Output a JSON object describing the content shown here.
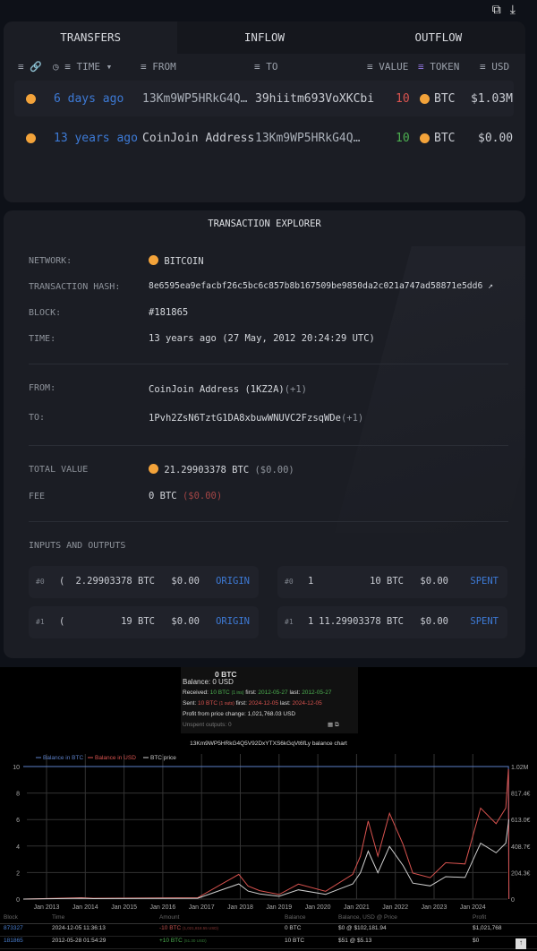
{
  "toolbar": {
    "copy_icon": "copy-icon",
    "download_icon": "download-icon"
  },
  "tabs": [
    {
      "label": "TRANSFERS",
      "active": true
    },
    {
      "label": "INFLOW"
    },
    {
      "label": "OUTFLOW"
    }
  ],
  "columns": {
    "time": "TIME",
    "from": "FROM",
    "to": "TO",
    "value": "VALUE",
    "token": "TOKEN",
    "usd": "USD"
  },
  "transfers": [
    {
      "time": "6 days ago",
      "from": "13Km9WP5HRkG4Q…",
      "to": "39hiitm693VoXKCbi",
      "value": "10",
      "direction": "out",
      "token": "BTC",
      "usd": "$1.03M"
    },
    {
      "time": "13 years ago",
      "from": "CoinJoin Address",
      "to": "13Km9WP5HRkG4Q…",
      "value": "10",
      "direction": "in",
      "token": "BTC",
      "usd": "$0.00"
    }
  ],
  "explorer": {
    "title": "TRANSACTION EXPLORER",
    "network_label": "NETWORK:",
    "network": "BITCOIN",
    "hash_label": "TRANSACTION HASH:",
    "hash": "8e6595ea9efacbf26c5bc6c857b8b167509be9850da2c021a747ad58871e5dd6",
    "block_label": "BLOCK:",
    "block": "#181865",
    "time_label": "TIME:",
    "time": "13 years ago",
    "time_full": "(27 May, 2012 20:24:29 UTC)",
    "from_label": "FROM:",
    "from": "CoinJoin Address (1KZ2A)",
    "from_more": "(+1)",
    "to_label": "TO:",
    "to": "1Pvh2ZsN6TztG1DA8xbuwWNUVC2FzsqWDe",
    "to_more": "(+1)",
    "total_label": "TOTAL VALUE",
    "total": "21.29903378 BTC",
    "total_usd": "($0.00)",
    "fee_label": "FEE",
    "fee": "0 BTC",
    "fee_usd": "($0.00)",
    "io_label": "INPUTS AND OUTPUTS",
    "inputs": [
      {
        "idx": "#0",
        "addr": "(",
        "amount": "2.29903378 BTC",
        "usd": "$0.00",
        "status": "ORIGIN"
      },
      {
        "idx": "#1",
        "addr": "(",
        "amount": "19 BTC",
        "usd": "$0.00",
        "status": "ORIGIN"
      }
    ],
    "outputs": [
      {
        "idx": "#0",
        "addr": "1",
        "amount": "10 BTC",
        "usd": "$0.00",
        "status": "SPENT"
      },
      {
        "idx": "#1",
        "addr": "1",
        "amount": "11.29903378 BTC",
        "usd": "$0.00",
        "status": "SPENT"
      }
    ]
  },
  "balance": {
    "btc": "0 BTC",
    "usd": "Balance: 0 USD",
    "received_label": "Received:",
    "received": "10 BTC",
    "received_ins": "(1 ins)",
    "received_first_label": "first:",
    "received_first": "2012-05-27",
    "received_last_label": "last:",
    "received_last": "2012-05-27",
    "sent_label": "Sent:",
    "sent": "10 BTC",
    "sent_outs": "(1 outs)",
    "sent_first_label": "first:",
    "sent_first": "2024-12-05",
    "sent_last_label": "last:",
    "sent_last": "2024-12-05",
    "profit_label": "Profit from price change:",
    "profit": "1,021,768.03 USD",
    "unspent": "Unspent outputs: 0",
    "chart_title": "13Km9WP5HRkG4Q5V92DxYTXS6kGqVt6fLy balance chart"
  },
  "chart_data": {
    "type": "line",
    "legend": [
      "Balance in BTC",
      "Balance in USD",
      "BTC price"
    ],
    "legend_placement": "top-left",
    "colors": {
      "btc": "#5b7fc7",
      "usd": "#d9534f",
      "price": "#cfcfcf"
    },
    "x_ticks": [
      "Jan 2013",
      "Jan 2014",
      "Jan 2015",
      "Jan 2016",
      "Jan 2017",
      "Jan 2018",
      "Jan 2019",
      "Jan 2020",
      "Jan 2021",
      "Jan 2022",
      "Jan 2023",
      "Jan 2024"
    ],
    "y_left_ticks": [
      "0",
      "2",
      "4",
      "6",
      "8",
      "10"
    ],
    "y_left_range": [
      0,
      10
    ],
    "y_right_ticks": [
      "0",
      "204.3€",
      "408.7€",
      "613.0€",
      "817.4€",
      "1.02M"
    ],
    "y_right_range": [
      0,
      1020000
    ],
    "grid": true,
    "series": [
      {
        "name": "Balance in BTC",
        "x": [
          2012.4,
          2024.92,
          2024.93
        ],
        "y": [
          10,
          10,
          0
        ]
      },
      {
        "name": "Balance in USD",
        "x": [
          2012.4,
          2013.9,
          2014.2,
          2016.9,
          2017.96,
          2018.2,
          2018.5,
          2019.0,
          2019.5,
          2020.2,
          2020.9,
          2021.1,
          2021.3,
          2021.55,
          2021.85,
          2022.2,
          2022.45,
          2022.9,
          2023.3,
          2023.8,
          2024.2,
          2024.6,
          2024.85,
          2024.92,
          2024.93
        ],
        "y": [
          51,
          10000,
          6000,
          10000,
          190000,
          100000,
          65000,
          35000,
          115000,
          60000,
          190000,
          330000,
          600000,
          330000,
          660000,
          420000,
          200000,
          165000,
          280000,
          270000,
          700000,
          580000,
          700000,
          1000000,
          0
        ]
      },
      {
        "name": "BTC price",
        "x": [
          2012.4,
          2013.9,
          2014.2,
          2016.9,
          2017.96,
          2018.2,
          2018.5,
          2019.0,
          2019.5,
          2020.2,
          2020.9,
          2021.1,
          2021.3,
          2021.55,
          2021.85,
          2022.2,
          2022.45,
          2022.9,
          2023.3,
          2023.8,
          2024.2,
          2024.6,
          2024.85,
          2024.93
        ],
        "y": [
          5,
          1000,
          600,
          1000,
          19000,
          10000,
          6500,
          3500,
          11500,
          6000,
          19000,
          33000,
          60000,
          33000,
          66000,
          42000,
          20000,
          16500,
          28000,
          27000,
          70000,
          58000,
          70000,
          100000
        ]
      }
    ]
  },
  "history": {
    "headers": [
      "Block",
      "Time",
      "Amount",
      "Balance",
      "Balance, USD @ Price",
      "Profit"
    ],
    "rows": [
      {
        "block": "873327",
        "time": "2024-12-05 11:36:13",
        "amount": "-10 BTC",
        "amount_usd": "(1,021,818.55 USD)",
        "balance": "0 BTC",
        "balance_usd": "$0 @ $102,181.94",
        "profit": "$1,021,768"
      },
      {
        "block": "181865",
        "time": "2012-05-28 01:54:29",
        "amount": "+10 BTC",
        "amount_usd": "(51.30 USD)",
        "balance": "10 BTC",
        "balance_usd": "$51 @ $5.13",
        "profit": "$0"
      }
    ]
  }
}
